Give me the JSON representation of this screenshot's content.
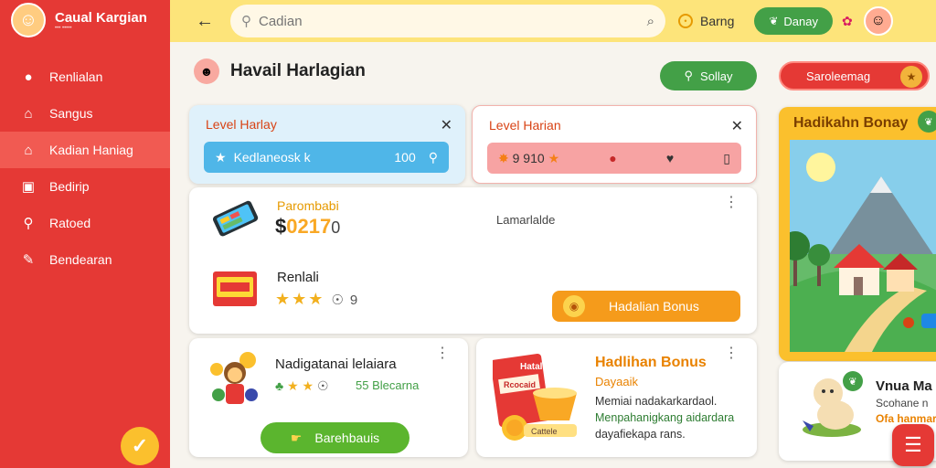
{
  "app": {
    "title": "Caual Kargian",
    "subtitle": "••• •••••"
  },
  "sidebar": {
    "items": [
      {
        "label": "Renlialan",
        "icon": "info-icon"
      },
      {
        "label": "Sangus",
        "icon": "home-icon"
      },
      {
        "label": "Kadian Haniag",
        "icon": "home-icon",
        "active": true
      },
      {
        "label": "Bedirip",
        "icon": "square-icon"
      },
      {
        "label": "Ratoed",
        "icon": "search-icon"
      },
      {
        "label": "Bendearan",
        "icon": "edit-icon"
      }
    ]
  },
  "topbar": {
    "search_placeholder": "Cadian",
    "status_label": "Barng",
    "action_label": "Danay"
  },
  "header": {
    "title": "Havail Harlagian",
    "green_button": "Sollay",
    "red_button": "Saroleemag"
  },
  "level_card_1": {
    "title": "Level Harlay",
    "bar_label": "Kedlaneosk k",
    "bar_value": "100"
  },
  "level_card_2": {
    "title": "Level Harian",
    "bar_label": "9 910"
  },
  "product": {
    "name": "Parombabi",
    "price_currency": "$",
    "price_value": "0217",
    "price_tail": "0",
    "middle_text": "Lamarlalde",
    "name2": "Renlali",
    "rating": 3,
    "rating_count": "9",
    "bonus_button": "Hadalian Bonus"
  },
  "card_bottom_left": {
    "title": "Nadigatanai lelaiara",
    "rating": 2,
    "count": "55 Blecarna",
    "button": "Barehbauis"
  },
  "card_bottom_mid": {
    "title": "Hadlihan Bonus",
    "subtitle": "Dayaaik",
    "desc_1": "Memiai nadakarkardaol.",
    "desc_2": "Menpahanigkang aidardara",
    "desc_3": "dayafiekapa rans.",
    "art_label_top": "Hatali",
    "art_label_mid": "Rcocaid",
    "art_label_bottom": "Cattele"
  },
  "promo": {
    "title": "Hadikahn Bonay"
  },
  "card_right_bottom": {
    "title": "Vnua Ma",
    "line1": "Scohane n",
    "line2": "Ofa hanmar"
  },
  "colors": {
    "sidebar": "#e53935",
    "topbar": "#fde47a",
    "accent_green": "#43a047",
    "accent_orange": "#f59b1b"
  }
}
